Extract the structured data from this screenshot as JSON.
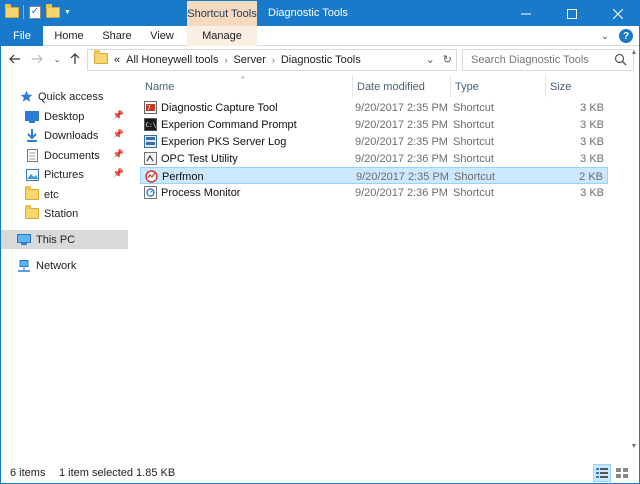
{
  "titlebar": {
    "context_tab": "Shortcut Tools",
    "title": "Diagnostic Tools",
    "controls": [
      "minimize-icon",
      "maximize-icon",
      "close-icon"
    ]
  },
  "ribbon": {
    "tabs": [
      "File",
      "Home",
      "Share",
      "View",
      "Manage"
    ]
  },
  "address": {
    "prefix": "«",
    "path": [
      "All Honeywell tools",
      "Server",
      "Diagnostic Tools"
    ],
    "search_placeholder": "Search Diagnostic Tools"
  },
  "nav": {
    "quick_access": "Quick access",
    "items": [
      {
        "label": "Desktop",
        "icon": "desktop-icon",
        "pinned": true
      },
      {
        "label": "Downloads",
        "icon": "downloads-icon",
        "pinned": true
      },
      {
        "label": "Documents",
        "icon": "documents-icon",
        "pinned": true
      },
      {
        "label": "Pictures",
        "icon": "pictures-icon",
        "pinned": true
      },
      {
        "label": "etc",
        "icon": "folder-icon",
        "pinned": false
      },
      {
        "label": "Station",
        "icon": "folder-icon",
        "pinned": false
      }
    ],
    "this_pc": "This PC",
    "network": "Network"
  },
  "columns": {
    "name": "Name",
    "date": "Date modified",
    "type": "Type",
    "size": "Size"
  },
  "files": [
    {
      "name": "Diagnostic Capture Tool",
      "date": "9/20/2017 2:35 PM",
      "type": "Shortcut",
      "size": "3 KB",
      "icon": "capture-tool-icon",
      "selected": false
    },
    {
      "name": "Experion Command Prompt",
      "date": "9/20/2017 2:35 PM",
      "type": "Shortcut",
      "size": "3 KB",
      "icon": "command-prompt-icon",
      "selected": false
    },
    {
      "name": "Experion PKS Server Log",
      "date": "9/20/2017 2:35 PM",
      "type": "Shortcut",
      "size": "3 KB",
      "icon": "server-log-icon",
      "selected": false
    },
    {
      "name": "OPC Test Utility",
      "date": "9/20/2017 2:36 PM",
      "type": "Shortcut",
      "size": "3 KB",
      "icon": "opc-utility-icon",
      "selected": false
    },
    {
      "name": "Perfmon",
      "date": "9/20/2017 2:35 PM",
      "type": "Shortcut",
      "size": "2 KB",
      "icon": "perfmon-icon",
      "selected": true
    },
    {
      "name": "Process Monitor",
      "date": "9/20/2017 2:36 PM",
      "type": "Shortcut",
      "size": "3 KB",
      "icon": "process-monitor-icon",
      "selected": false
    }
  ],
  "status": {
    "item_count": "6 items",
    "selection": "1 item selected  1.85 KB"
  },
  "colors": {
    "accent": "#1979ca",
    "context_tab": "#f6d9bf",
    "selection": "#cce8ff"
  }
}
